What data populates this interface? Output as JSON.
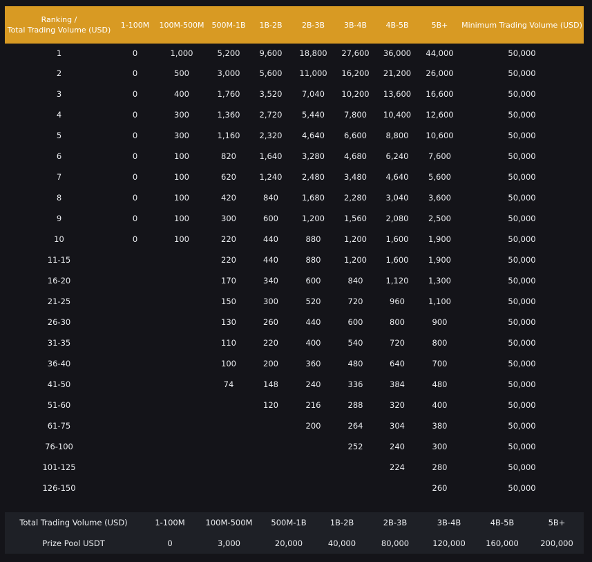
{
  "ranking_table": {
    "headers": [
      "Ranking /",
      "Total Trading Volume (USD)",
      "1-100M",
      "100M-500M",
      "500M-1B",
      "1B-2B",
      "2B-3B",
      "3B-4B",
      "4B-5B",
      "5B+",
      "Minimum Trading Volume (USD)"
    ],
    "rows": [
      [
        "1",
        "0",
        "1,000",
        "5,200",
        "9,600",
        "18,800",
        "27,600",
        "36,000",
        "44,000",
        "50,000"
      ],
      [
        "2",
        "0",
        "500",
        "3,000",
        "5,600",
        "11,000",
        "16,200",
        "21,200",
        "26,000",
        "50,000"
      ],
      [
        "3",
        "0",
        "400",
        "1,760",
        "3,520",
        "7,040",
        "10,200",
        "13,600",
        "16,600",
        "50,000"
      ],
      [
        "4",
        "0",
        "300",
        "1,360",
        "2,720",
        "5,440",
        "7,800",
        "10,400",
        "12,600",
        "50,000"
      ],
      [
        "5",
        "0",
        "300",
        "1,160",
        "2,320",
        "4,640",
        "6,600",
        "8,800",
        "10,600",
        "50,000"
      ],
      [
        "6",
        "0",
        "100",
        "820",
        "1,640",
        "3,280",
        "4,680",
        "6,240",
        "7,600",
        "50,000"
      ],
      [
        "7",
        "0",
        "100",
        "620",
        "1,240",
        "2,480",
        "3,480",
        "4,640",
        "5,600",
        "50,000"
      ],
      [
        "8",
        "0",
        "100",
        "420",
        "840",
        "1,680",
        "2,280",
        "3,040",
        "3,600",
        "50,000"
      ],
      [
        "9",
        "0",
        "100",
        "300",
        "600",
        "1,200",
        "1,560",
        "2,080",
        "2,500",
        "50,000"
      ],
      [
        "10",
        "0",
        "100",
        "220",
        "440",
        "880",
        "1,200",
        "1,600",
        "1,900",
        "50,000"
      ],
      [
        "11-15",
        "",
        "",
        "220",
        "440",
        "880",
        "1,200",
        "1,600",
        "1,900",
        "50,000"
      ],
      [
        "16-20",
        "",
        "",
        "170",
        "340",
        "600",
        "840",
        "1,120",
        "1,300",
        "50,000"
      ],
      [
        "21-25",
        "",
        "",
        "150",
        "300",
        "520",
        "720",
        "960",
        "1,100",
        "50,000"
      ],
      [
        "26-30",
        "",
        "",
        "130",
        "260",
        "440",
        "600",
        "800",
        "900",
        "50,000"
      ],
      [
        "31-35",
        "",
        "",
        "110",
        "220",
        "400",
        "540",
        "720",
        "800",
        "50,000"
      ],
      [
        "36-40",
        "",
        "",
        "100",
        "200",
        "360",
        "480",
        "640",
        "700",
        "50,000"
      ],
      [
        "41-50",
        "",
        "",
        "74",
        "148",
        "240",
        "336",
        "384",
        "480",
        "50,000"
      ],
      [
        "51-60",
        "",
        "",
        "",
        "120",
        "216",
        "288",
        "320",
        "400",
        "50,000"
      ],
      [
        "61-75",
        "",
        "",
        "",
        "",
        "200",
        "264",
        "304",
        "380",
        "50,000"
      ],
      [
        "76-100",
        "",
        "",
        "",
        "",
        "",
        "252",
        "240",
        "300",
        "50,000"
      ],
      [
        "101-125",
        "",
        "",
        "",
        "",
        "",
        "",
        "224",
        "280",
        "50,000"
      ],
      [
        "126-150",
        "",
        "",
        "",
        "",
        "",
        "",
        "",
        "260",
        "50,000"
      ]
    ]
  },
  "prize_pool_table": {
    "headers": [
      "Total Trading Volume (USD)",
      "1-100M",
      "100M-500M",
      "500M-1B",
      "1B-2B",
      "2B-3B",
      "3B-4B",
      "4B-5B",
      "5B+"
    ],
    "values": [
      "Prize Pool USDT",
      "0",
      "3,000",
      "20,000",
      "40,000",
      "80,000",
      "120,000",
      "160,000",
      "200,000"
    ]
  },
  "colors": {
    "background": "#141419",
    "header_accent": "#d89a23",
    "pool_panel": "#1e2026",
    "text": "#eaecef"
  }
}
